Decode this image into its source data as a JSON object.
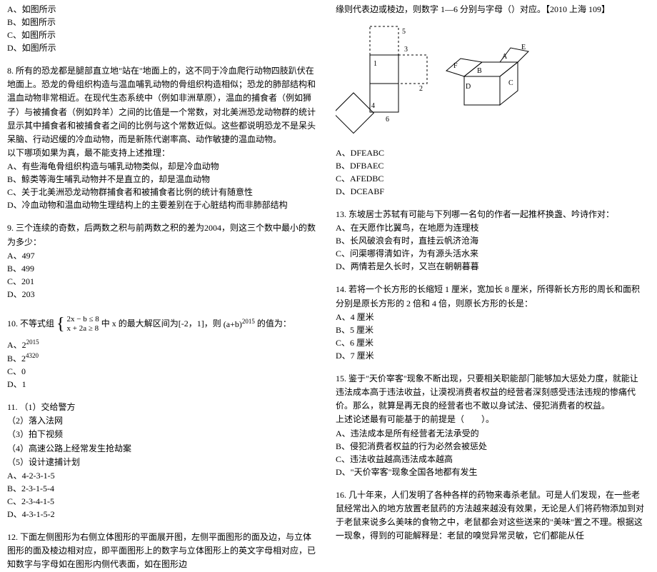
{
  "q7_choices": {
    "a": "A、如图所示",
    "b": "B、如图所示",
    "c": "C、如图所示",
    "d": "D、如图所示"
  },
  "q8": {
    "stem": "8. 所有的恐龙都是腿部直立地\"站在\"地面上的，这不同于冷血爬行动物四肢趴伏在地面上。恐龙的骨组织构造与温血哺乳动物的骨组织构造相似；恐龙的肺部结构和温血动物非常相近。在现代生态系统中（例如非洲草原），温血的捕食者（例如狮子）与被捕食者（例如羚羊）之间的比值是一个常数，对北美洲恐龙动物群的统计显示其中捕食者和被捕食者之间的比例与这个常数近似。这些都说明恐龙不是呆头呆脑、行动迟缓的冷血动物，而是新陈代谢率高、动作敏捷的温血动物。",
    "sub": "以下哪项如果为真，最不能支持上述推理：",
    "a": "A、有些海龟骨组织构造与哺乳动物类似，却是冷血动物",
    "b": "B、鲸类等海生哺乳动物并不是直立的，却是温血动物",
    "c": "C、关于北美洲恐龙动物群捕食者和被捕食者比例的统计有随意性",
    "d": "D、冷血动物和温血动物生理结构上的主要差别在于心脏结构而非肺部结构"
  },
  "q9": {
    "stem": "9. 三个连续的奇数，后两数之积与前两数之积的差为2004，则这三个数中最小的数为多少：",
    "a": "A、497",
    "b": "B、499",
    "c": "C、201",
    "d": "D、203"
  },
  "q10": {
    "prefix": "10. 不等式组",
    "line1": "2x − b ≤ 8",
    "line2": "x + 2a ≥ 8",
    "mid": " 中 x 的最大解区间为[-2，1]，则",
    "exp": "(a+b)",
    "sup": "2015",
    "suffix": "的值为：",
    "a_label": "A、",
    "a_val": "2",
    "a_sup": "2015",
    "b_label": "B、",
    "b_val": "2",
    "b_sup": "4320",
    "c": "C、0",
    "d": "D、1"
  },
  "q11": {
    "stem": "11. （1）交给警方",
    "l2": "（2）落入法网",
    "l3": "（3）拍下视频",
    "l4": "（4）高速公路上经常发生抢劫案",
    "l5": "（5）设计逮捕计划",
    "a": "A、4-2-3-1-5",
    "b": "B、2-3-1-5-4",
    "c": "C、2-3-4-1-5",
    "d": "D、4-3-1-5-2"
  },
  "q12": {
    "stem": "12. 下面左侧图形为右侧立体图形的平面展开图，左侧平面图形的面及边，与立体图形的面及棱边相对应，即平面图形上的数字与立体图形上的英文字母相对应，已知数字与字母如在图形内侧代表面，如在图形边",
    "cont": "缘则代表边或棱边，则数字 1—6 分别与字母（）对应。【2010 上海 109】",
    "a": "A、DFEABC",
    "b": "B、DFBAEC",
    "c": "C、AFEDBC",
    "d": "D、DCEABF"
  },
  "q13": {
    "stem": "13. 东坡居士苏轼有可能与下列哪一名句的作者一起推杯换盏、吟诗作对：",
    "a": "A、在天愿作比翼鸟，在地愿为连理枝",
    "b": "B、长风破浪会有时，直挂云帆济沧海",
    "c": "C、问渠哪得清如许，为有源头活水来",
    "d": "D、两情若是久长时，又岂在朝朝暮暮"
  },
  "q14": {
    "stem": "14. 若将一个长方形的长缩短 1 厘米，宽加长 8 厘米，所得新长方形的周长和面积分别是原长方形的 2 倍和 4 倍，则原长方形的长是：",
    "a": "A、4 厘米",
    "b": "B、5 厘米",
    "c": "C、6 厘米",
    "d": "D、7 厘米"
  },
  "q15": {
    "stem": "15. 鉴于\"天价宰客\"现象不断出现，只要相关职能部门能够加大惩处力度，就能让违法成本高于违法收益，让漠视消费者权益的经营者深刻感受违法违规的惨痛代价。那么，就算是再无良的经营者也不敢以身试法、侵犯消费者的权益。",
    "sub": "上述论述最有可能基于的前提是（　　）。",
    "a": "A、违法成本是所有经营者无法承受的",
    "b": "B、侵犯消费者权益的行为必然会被惩处",
    "c": "C、违法收益越高违法成本越高",
    "d": "D、\"天价宰客\"现象全国各地都有发生"
  },
  "q16": {
    "stem": "16. 几十年来，人们发明了各种各样的药物来毒杀老鼠。可是人们发现，在一些老鼠经常出入的地方放置老鼠药的方法越来越没有效果，无论是人们将药物添加到对于老鼠来说多么美味的食物之中，老鼠都会对这些送来的\"美味\"置之不理。根据这一现象，得到的可能解释是：老鼠的嗅觉异常灵敏，它们都能从任"
  }
}
